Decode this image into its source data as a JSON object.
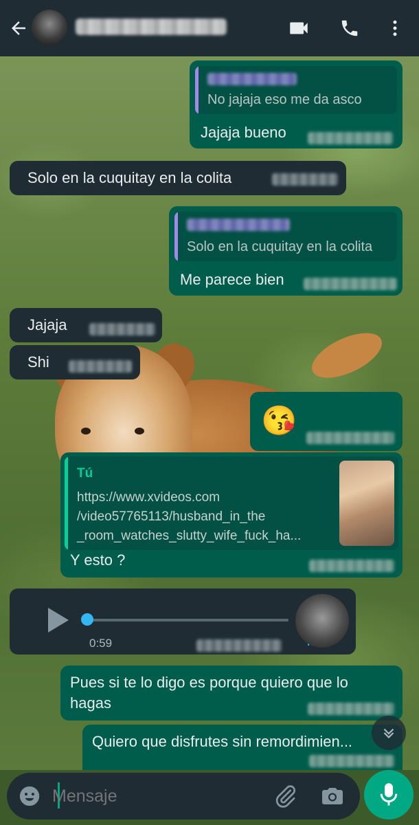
{
  "colors": {
    "header": "#1f2c34",
    "outgoing_bubble": "#005c4b",
    "incoming_bubble": "#1f2c34",
    "accent": "#00a884",
    "quote_bar": "#a487e8",
    "link_author": "#06cf9c",
    "voice_progress": "#34b7f1"
  },
  "header": {
    "icons": [
      "arrow-back-icon",
      "video-call-icon",
      "phone-call-icon",
      "more-vertical-icon"
    ]
  },
  "messages": [
    {
      "dir": "out",
      "quote": "No jajaja eso me da asco",
      "text": "Jajaja bueno"
    },
    {
      "dir": "in",
      "text": "Solo en la cuquitay en la colita"
    },
    {
      "dir": "out",
      "quote": "Solo en la cuquitay en la colita",
      "text": "Me parece bien"
    },
    {
      "dir": "in",
      "text": "Jajaja"
    },
    {
      "dir": "in",
      "text": "Shi"
    },
    {
      "dir": "out",
      "emoji": "😘"
    },
    {
      "dir": "out",
      "link_preview": {
        "author": "Tú",
        "url_lines": [
          "https://www.xvideos.com",
          "/video57765113/husband_in_the",
          "_room_watches_slutty_wife_fuck_ha..."
        ]
      },
      "text": "Y esto ?"
    },
    {
      "dir": "in",
      "voice": {
        "duration": "0:59",
        "progress": 0.0
      }
    },
    {
      "dir": "out",
      "text_lines": [
        "Pues si te lo digo es porque quiero que lo",
        "hagas"
      ]
    },
    {
      "dir": "out",
      "text": "Quiero que disfrutes sin remordimien..."
    }
  ],
  "composer": {
    "placeholder": "Mensaje",
    "icons": [
      "emoji-icon",
      "attach-icon",
      "camera-icon",
      "mic-icon"
    ]
  }
}
